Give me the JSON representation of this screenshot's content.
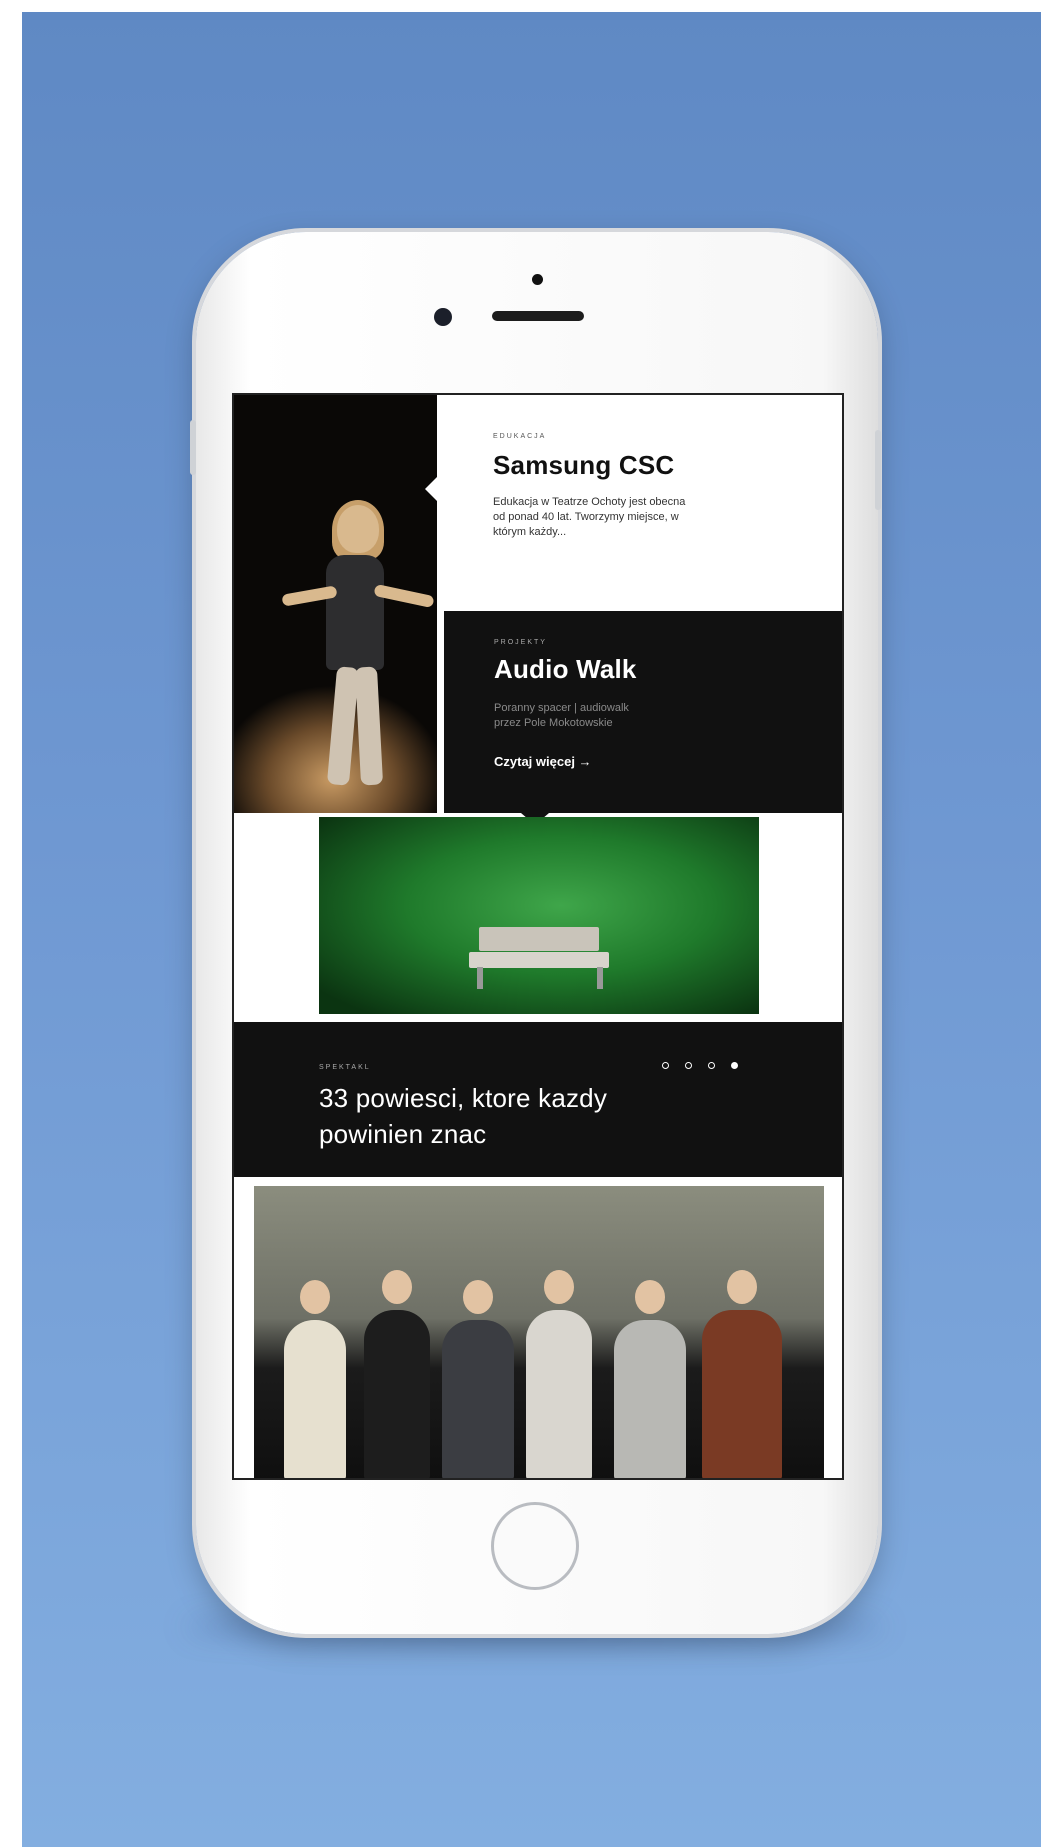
{
  "cards": [
    {
      "eyebrow": "EDUKACJA",
      "title": "Samsung CSC",
      "desc_lines": [
        "Edukacja w Teatrze Ochoty jest obecna",
        "od ponad 40 lat. Tworzymy miejsce, w",
        "którym każdy..."
      ]
    },
    {
      "eyebrow": "PROJEKTY",
      "title": "Audio Walk",
      "desc_lines": [
        "Poranny spacer | audiowalk",
        "przez Pole Mokotowskie"
      ],
      "read_more": "Czytaj więcej →"
    }
  ],
  "spektakl": {
    "eyebrow": "SPEKTAKL",
    "title_lines": [
      "33 powiesci, ktore kazdy",
      "powinien znac"
    ],
    "carousel": {
      "total": 4,
      "active": 4
    }
  },
  "colors": {
    "background": "#6f98d2",
    "dark_panel": "#111111",
    "phone_body": "#f7f7f7"
  },
  "icons": {
    "play": "play-icon",
    "arrow": "arrow-right-icon"
  }
}
